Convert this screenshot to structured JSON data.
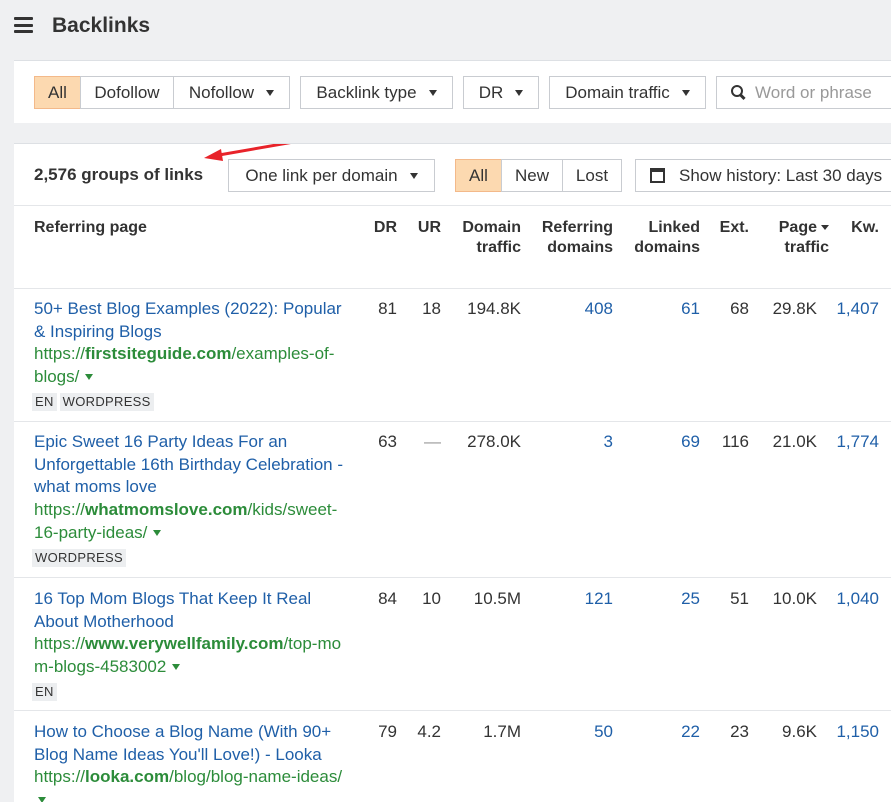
{
  "header": {
    "title": "Backlinks"
  },
  "filters": {
    "type_tabs": [
      "All",
      "Dofollow",
      "Nofollow"
    ],
    "backlink_type": "Backlink type",
    "dr": "DR",
    "domain_traffic": "Domain traffic",
    "search_placeholder": "Word or phrase"
  },
  "results": {
    "count_label": "2,576 groups of links",
    "grouping": "One link per domain",
    "status_tabs": [
      "All",
      "New",
      "Lost"
    ],
    "history": "Show history: Last 30 days"
  },
  "columns": {
    "referring_page": "Referring page",
    "dr": "DR",
    "ur": "UR",
    "domain_traffic_1": "Domain",
    "domain_traffic_2": "traffic",
    "referring_domains_1": "Referring",
    "referring_domains_2": "domains",
    "linked_domains_1": "Linked",
    "linked_domains_2": "domains",
    "ext": "Ext.",
    "page_traffic_1": "Page",
    "page_traffic_2": "traffic",
    "kw": "Kw."
  },
  "rows": [
    {
      "title_lines": [
        "50+ Best Blog Examples (2022): Popular",
        "& Inspiring Blogs"
      ],
      "url_prefix": "https://",
      "url_domain": "firstsiteguide.com",
      "url_path_lines": [
        "/examples-of-",
        "blogs/"
      ],
      "tags": [
        "EN",
        "WORDPRESS"
      ],
      "dr": "81",
      "ur": "18",
      "domain_traffic": "194.8K",
      "referring_domains": "408",
      "linked_domains": "61",
      "ext": "68",
      "page_traffic": "29.8K",
      "kw": "1,407"
    },
    {
      "title_lines": [
        "Epic Sweet 16 Party Ideas For an",
        "Unforgettable 16th Birthday Celebration -",
        "what moms love"
      ],
      "url_prefix": "https://",
      "url_domain": "whatmomslove.com",
      "url_path_lines": [
        "/kids/sweet-",
        "16-party-ideas/"
      ],
      "tags": [
        "WORDPRESS"
      ],
      "dr": "63",
      "ur": "—",
      "domain_traffic": "278.0K",
      "referring_domains": "3",
      "linked_domains": "69",
      "ext": "116",
      "page_traffic": "21.0K",
      "kw": "1,774"
    },
    {
      "title_lines": [
        "16 Top Mom Blogs That Keep It Real",
        "About Motherhood"
      ],
      "url_prefix": "https://",
      "url_domain": "www.verywellfamily.com",
      "url_path_lines": [
        "/top-mo",
        "m-blogs-4583002"
      ],
      "tags": [
        "EN"
      ],
      "dr": "84",
      "ur": "10",
      "domain_traffic": "10.5M",
      "referring_domains": "121",
      "linked_domains": "25",
      "ext": "51",
      "page_traffic": "10.0K",
      "kw": "1,040"
    },
    {
      "title_lines": [
        "How to Choose a Blog Name (With 90+",
        "Blog Name Ideas You'll Love!) - Looka"
      ],
      "url_prefix": "https://",
      "url_domain": "looka.com",
      "url_path_lines": [
        "/blog/blog-name-ideas/"
      ],
      "tags": [],
      "dr": "79",
      "ur": "4.2",
      "domain_traffic": "1.7M",
      "referring_domains": "50",
      "linked_domains": "22",
      "ext": "23",
      "page_traffic": "9.6K",
      "kw": "1,150"
    }
  ],
  "colors": {
    "accent": "#fcd9b0",
    "link": "#1f5fa8",
    "url": "#2c8c3a",
    "arrow": "#e8232a"
  }
}
